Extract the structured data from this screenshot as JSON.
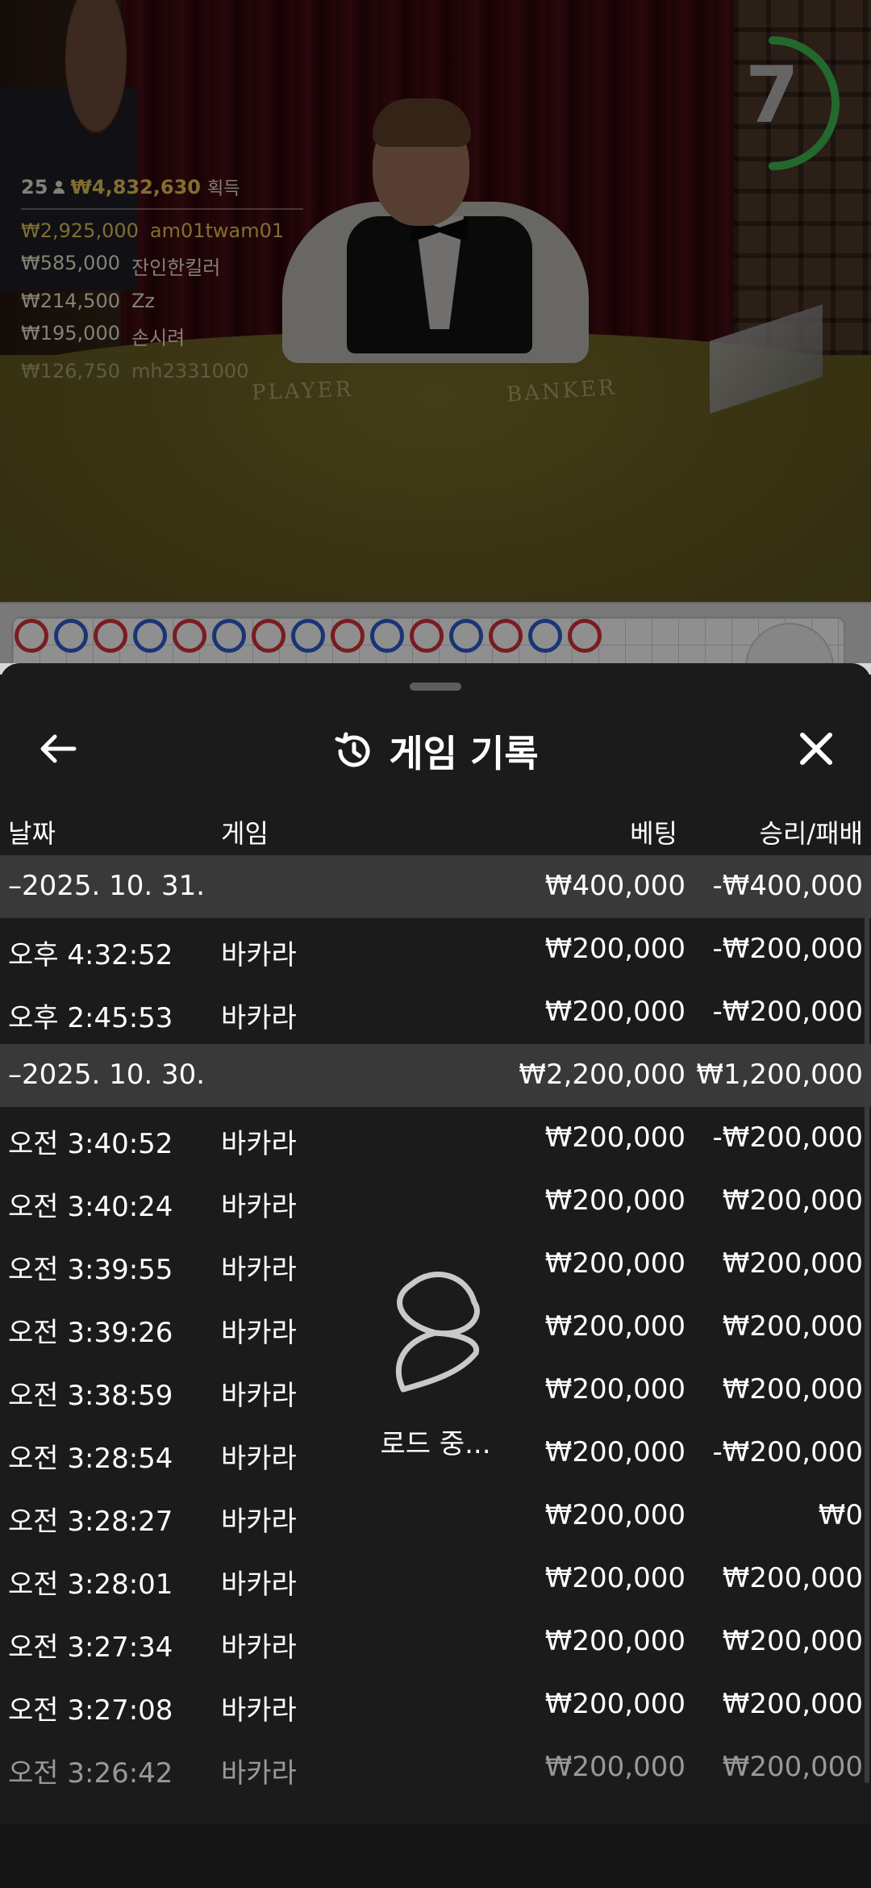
{
  "overlay": {
    "countdown": "7",
    "winners": {
      "count": "25",
      "total": "₩4,832,630",
      "suffix": "획득",
      "list": [
        {
          "amount": "₩2,925,000",
          "name": "am01twam01"
        },
        {
          "amount": "₩585,000",
          "name": "잔인한킬러"
        },
        {
          "amount": "₩214,500",
          "name": "Zz"
        },
        {
          "amount": "₩195,000",
          "name": "손시려"
        },
        {
          "amount": "₩126,750",
          "name": "mh2331000"
        }
      ]
    },
    "table_labels": {
      "player": "PLAYER",
      "banker": "BANKER"
    }
  },
  "sheet": {
    "title": "게임 기록",
    "columns": {
      "date": "날짜",
      "game": "게임",
      "bet": "베팅",
      "result": "승리/패배"
    },
    "rows": [
      {
        "type": "group",
        "date": "–2025. 10. 31.",
        "bet": "₩400,000",
        "result": "-₩400,000"
      },
      {
        "type": "item",
        "time": "오후 4:32:52",
        "game": "바카라",
        "bet": "₩200,000",
        "result": "-₩200,000"
      },
      {
        "type": "item",
        "time": "오후 2:45:53",
        "game": "바카라",
        "bet": "₩200,000",
        "result": "-₩200,000"
      },
      {
        "type": "group",
        "date": "–2025. 10. 30.",
        "bet": "₩2,200,000",
        "result": "₩1,200,000"
      },
      {
        "type": "item",
        "time": "오전 3:40:52",
        "game": "바카라",
        "bet": "₩200,000",
        "result": "-₩200,000"
      },
      {
        "type": "item",
        "time": "오전 3:40:24",
        "game": "바카라",
        "bet": "₩200,000",
        "result": "₩200,000"
      },
      {
        "type": "item",
        "time": "오전 3:39:55",
        "game": "바카라",
        "bet": "₩200,000",
        "result": "₩200,000"
      },
      {
        "type": "item",
        "time": "오전 3:39:26",
        "game": "바카라",
        "bet": "₩200,000",
        "result": "₩200,000"
      },
      {
        "type": "item",
        "time": "오전 3:38:59",
        "game": "바카라",
        "bet": "₩200,000",
        "result": "₩200,000"
      },
      {
        "type": "item",
        "time": "오전 3:28:54",
        "game": "바카라",
        "bet": "₩200,000",
        "result": "-₩200,000"
      },
      {
        "type": "item",
        "time": "오전 3:28:27",
        "game": "바카라",
        "bet": "₩200,000",
        "result": "₩0"
      },
      {
        "type": "item",
        "time": "오전 3:28:01",
        "game": "바카라",
        "bet": "₩200,000",
        "result": "₩200,000"
      },
      {
        "type": "item",
        "time": "오전 3:27:34",
        "game": "바카라",
        "bet": "₩200,000",
        "result": "₩200,000"
      },
      {
        "type": "item",
        "time": "오전 3:27:08",
        "game": "바카라",
        "bet": "₩200,000",
        "result": "₩200,000"
      },
      {
        "type": "item",
        "time": "오전 3:26:42",
        "game": "바카라",
        "bet": "₩200,000",
        "result": "₩200,000"
      }
    ],
    "loading_text": "로드 중..."
  },
  "icons": {
    "back": "arrow-left-icon",
    "history": "history-icon",
    "close": "close-icon",
    "loading": "spinner-icon"
  },
  "colors": {
    "gold": "#e6c456",
    "timer_green": "#3fb950",
    "sheet_bg": "#1b1b1b",
    "group_bg": "#393939",
    "banker_red": "#d8323e",
    "player_blue": "#2f5fd0"
  }
}
